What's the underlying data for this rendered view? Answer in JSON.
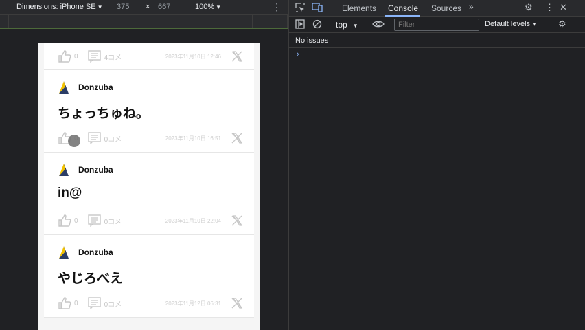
{
  "device_toolbar": {
    "dimensions_label": "Dimensions: iPhone SE",
    "width": "375",
    "times": "×",
    "height": "667",
    "zoom": "100%"
  },
  "devtools": {
    "tabs": [
      "Elements",
      "Console",
      "Sources"
    ],
    "active_tab": "Console",
    "more_tabs": "»",
    "context": "top",
    "filter_placeholder": "Filter",
    "levels": "Default levels",
    "issues": "No issues",
    "prompt": "›"
  },
  "posts": [
    {
      "user": "",
      "text": "",
      "likes": "0",
      "comments": "4コメ",
      "date": "2023年11月10日 12:46"
    },
    {
      "user": "Donzuba",
      "text": "ちょっちゅね。",
      "likes": "0",
      "comments": "0コメ",
      "date": "2023年11月10日 16:51"
    },
    {
      "user": "Donzuba",
      "text": "in@",
      "likes": "0",
      "comments": "0コメ",
      "date": "2023年11月10日 22:04"
    },
    {
      "user": "Donzuba",
      "text": "やじろべえ",
      "likes": "0",
      "comments": "0コメ",
      "date": "2023年11月12日 06:31"
    }
  ],
  "colors": {
    "devtools_bg": "#202124",
    "accent": "#8ab4f8",
    "avatar_yellow": "#f2c200",
    "avatar_navy": "#1d2a4a"
  }
}
